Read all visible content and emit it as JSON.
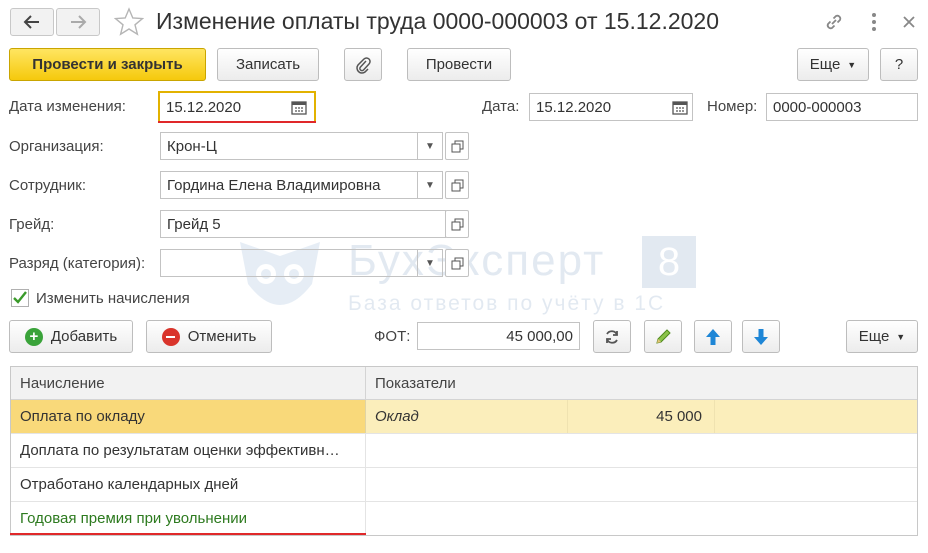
{
  "header": {
    "title": "Изменение оплаты труда 0000-000003 от 15.12.2020"
  },
  "toolbar": {
    "post_close": "Провести и закрыть",
    "save": "Записать",
    "post": "Провести",
    "more": "Еще",
    "help": "?"
  },
  "form": {
    "change_date_label": "Дата изменения:",
    "change_date": "15.12.2020",
    "date_label": "Дата:",
    "date": "15.12.2020",
    "number_label": "Номер:",
    "number": "0000-000003",
    "org_label": "Организация:",
    "org": "Крон-Ц",
    "employee_label": "Сотрудник:",
    "employee": "Гордина Елена Владимировна",
    "grade_label": "Грейд:",
    "grade": "Грейд 5",
    "rank_label": "Разряд (категория):",
    "rank": "",
    "change_accruals_label": "Изменить начисления",
    "change_accruals_checked": true
  },
  "accruals_toolbar": {
    "add": "Добавить",
    "cancel": "Отменить",
    "fot_label": "ФОТ:",
    "fot": "45 000,00",
    "more": "Еще"
  },
  "table": {
    "columns": [
      "Начисление",
      "Показатели"
    ],
    "rows": [
      {
        "name": "Оплата по окладу",
        "indicator": "Оклад",
        "value": "45 000"
      },
      {
        "name": "Доплата по результатам оценки эффективн…",
        "indicator": "",
        "value": ""
      },
      {
        "name": "Отработано календарных дней",
        "indicator": "",
        "value": ""
      },
      {
        "name": "Годовая премия при увольнении",
        "indicator": "",
        "value": ""
      }
    ]
  },
  "watermark": {
    "brand": "БухЭксперт",
    "badge": "8",
    "tagline": "База ответов по учёту в 1С"
  },
  "colors": {
    "primary_button": "#f5c90c",
    "selected_row": "#fbeebb",
    "highlight_underline": "#e0282a",
    "new_row_text": "#2d7a1f",
    "accent_blue": "#1e86d6"
  }
}
